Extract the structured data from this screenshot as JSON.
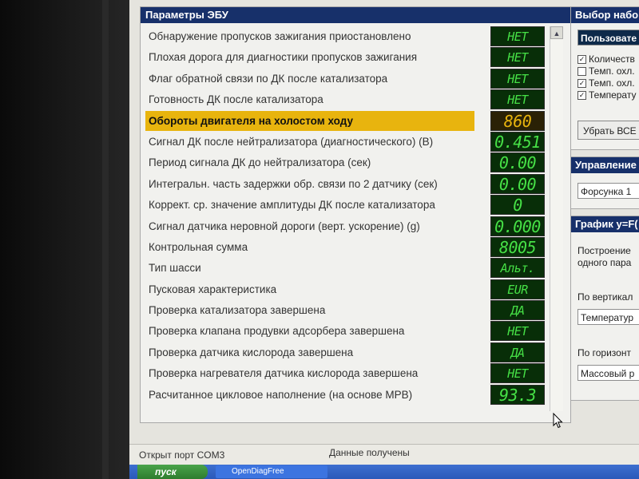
{
  "ecu_panel": {
    "title": "Параметры ЭБУ",
    "rows": [
      {
        "label": "Обнаружение пропусков зажигания приостановлено",
        "value": "НЕТ"
      },
      {
        "label": "Плохая дорога для диагностики пропусков зажигания",
        "value": "НЕТ"
      },
      {
        "label": "Флаг обратной связи по ДК после катализатора",
        "value": "НЕТ"
      },
      {
        "label": "Готовность ДК после катализатора",
        "value": "НЕТ"
      },
      {
        "label": "Обороты двигателя на холостом ходу",
        "value": "860"
      },
      {
        "label": "Сигнал ДК после нейтрализатора (диагностического) (В)",
        "value": "0.451"
      },
      {
        "label": "Период сигнала ДК до нейтрализатора (сек)",
        "value": "0.00"
      },
      {
        "label": "Интегральн. часть задержки обр. связи по 2 датчику (сек)",
        "value": "0.00"
      },
      {
        "label": "Коррект. ср. значение амплитуды ДК после катализатора",
        "value": "0"
      },
      {
        "label": "Сигнал датчика неровной дороги (верт. ускорение) (g)",
        "value": "0.000"
      },
      {
        "label": "Контрольная сумма",
        "value": "8005"
      },
      {
        "label": "Тип шасси",
        "value": "Альт."
      },
      {
        "label": "Пусковая характеристика",
        "value": "EUR"
      },
      {
        "label": "Проверка катализатора завершена",
        "value": "ДА"
      },
      {
        "label": "Проверка клапана продувки адсорбера завершена",
        "value": "НЕТ"
      },
      {
        "label": "Проверка датчика кислорода завершена",
        "value": "ДА"
      },
      {
        "label": "Проверка нагревателя датчика кислорода завершена",
        "value": "НЕТ"
      },
      {
        "label": "Расчитанное цикловое наполнение (на основе МРВ)",
        "value": "93.3"
      }
    ],
    "highlight_color": "#e8b40e",
    "value_color": "#46e046"
  },
  "right_panel": {
    "select_title": "Выбор набо",
    "select_value": "Пользовате",
    "checkboxes": [
      {
        "label": "Количеств",
        "checked": true
      },
      {
        "label": "Темп. охл.",
        "checked": false
      },
      {
        "label": "Темп. охл.",
        "checked": true
      },
      {
        "label": "Температу",
        "checked": true
      }
    ],
    "clear_button": "Убрать ВСЕ",
    "control_title": "Управление",
    "control_value": "Форсунка 1",
    "graph_title": "График y=F(",
    "graph_desc_1": "Построение",
    "graph_desc_2": "одного пара",
    "vertical_label": "По вертикал",
    "vertical_value": "Температур",
    "horizontal_label": "По горизонт",
    "horizontal_value": "Массовый р"
  },
  "statusbar": {
    "port": "Открыт порт COM3",
    "status": "Данные получены"
  },
  "taskbar": {
    "start": "пуск",
    "task": "OpenDiagFree"
  }
}
